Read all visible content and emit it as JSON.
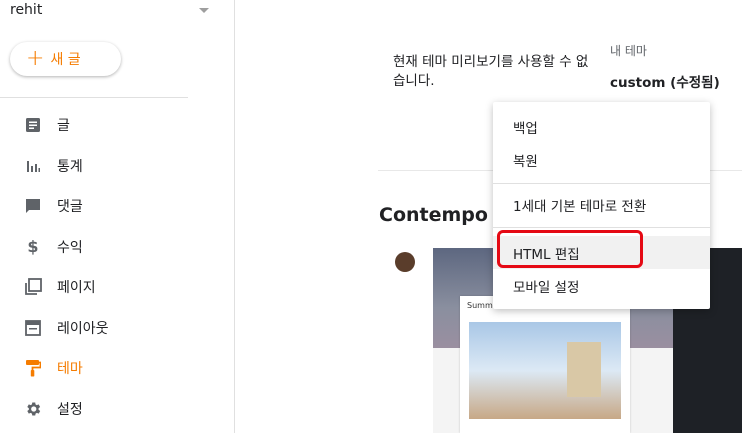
{
  "sidebar": {
    "blog_name": "rehit",
    "new_post_label": "새 글",
    "items": [
      {
        "label": "글",
        "icon": "posts-icon",
        "active": false
      },
      {
        "label": "통계",
        "icon": "stats-icon",
        "active": false
      },
      {
        "label": "댓글",
        "icon": "comment-icon",
        "active": false
      },
      {
        "label": "수익",
        "icon": "dollar-icon",
        "active": false
      },
      {
        "label": "페이지",
        "icon": "pages-icon",
        "active": false
      },
      {
        "label": "레이아웃",
        "icon": "layout-icon",
        "active": false
      },
      {
        "label": "테마",
        "icon": "paint-roller-icon",
        "active": true
      },
      {
        "label": "설정",
        "icon": "gear-icon",
        "active": false
      }
    ]
  },
  "main": {
    "preview_note": "현재 테마 미리보기를 사용할 수 없습니다.",
    "my_theme_label": "내 테마",
    "my_theme_name": "custom (수정됨)",
    "theme_section_title": "Contempo",
    "thumbnail_post_title": "Summer"
  },
  "menu": {
    "items": [
      "백업",
      "복원",
      "1세대 기본 테마로 전환",
      "HTML 편집",
      "모바일 설정"
    ],
    "highlighted": "HTML 편집"
  },
  "colors": {
    "accent": "#f57c00",
    "highlight_border": "#e50914"
  }
}
